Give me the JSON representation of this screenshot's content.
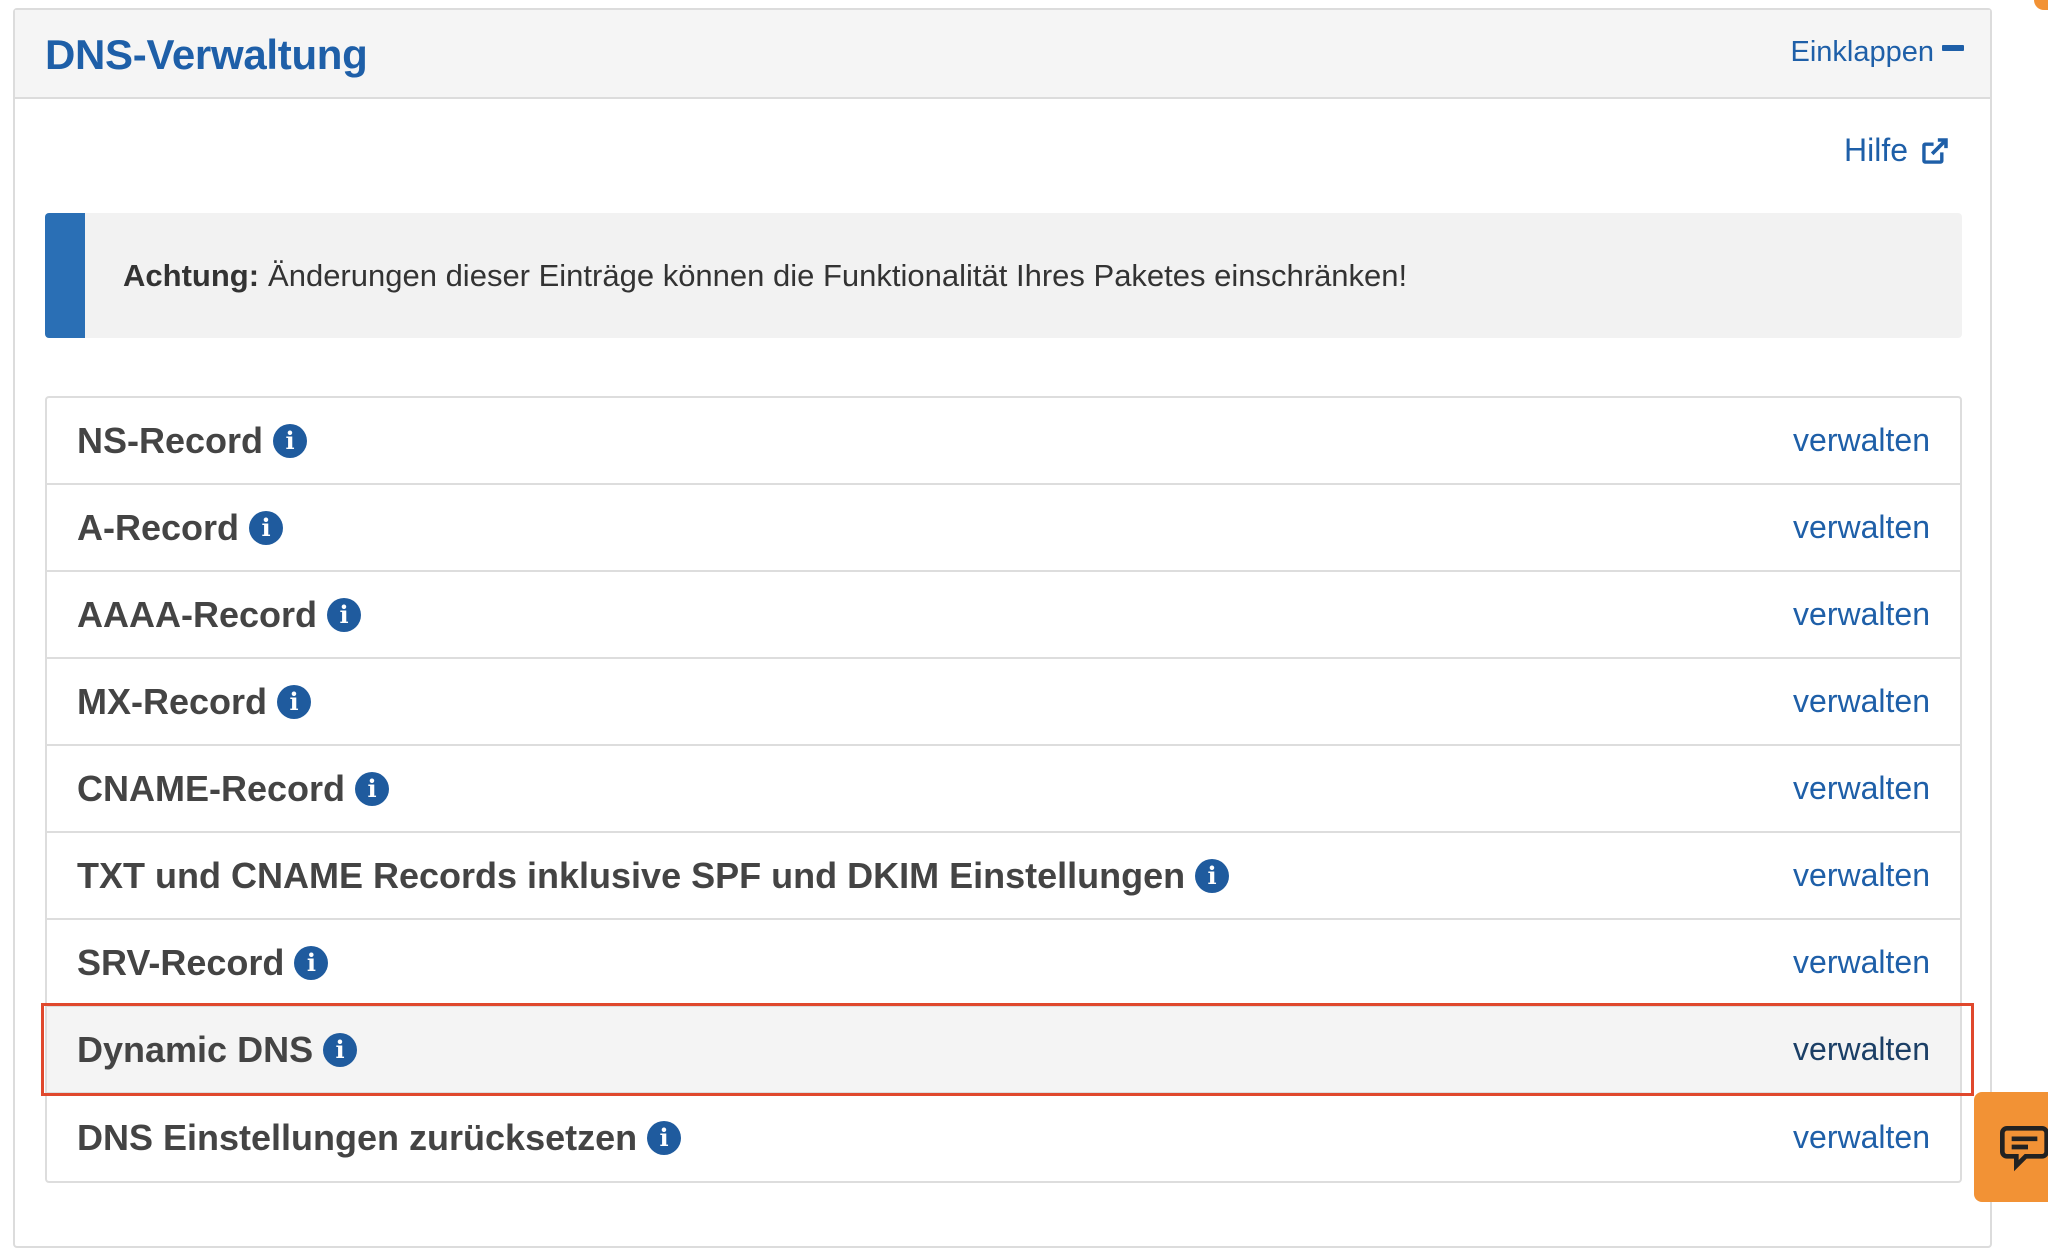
{
  "panel": {
    "title": "DNS-Verwaltung",
    "collapse_label": "Einklappen",
    "help_label": "Hilfe"
  },
  "alert": {
    "strong": "Achtung:",
    "text": "Änderungen dieser Einträge können die Funktionalität Ihres Paketes einschränken!"
  },
  "records": [
    {
      "label": "NS-Record",
      "action": "verwalten"
    },
    {
      "label": "A-Record",
      "action": "verwalten"
    },
    {
      "label": "AAAA-Record",
      "action": "verwalten"
    },
    {
      "label": "MX-Record",
      "action": "verwalten"
    },
    {
      "label": "CNAME-Record",
      "action": "verwalten"
    },
    {
      "label": "TXT und CNAME Records inklusive SPF und DKIM Einstellungen",
      "action": "verwalten"
    },
    {
      "label": "SRV-Record",
      "action": "verwalten"
    },
    {
      "label": "Dynamic DNS",
      "action": "verwalten"
    },
    {
      "label": "DNS Einstellungen zurücksetzen",
      "action": "verwalten"
    }
  ],
  "info_icon_glyph": "i",
  "colors": {
    "primary": "#1e5fa8",
    "highlight_border": "#e0482d",
    "alert_bar": "#2a6fb5",
    "chat_widget": "#f29235"
  }
}
